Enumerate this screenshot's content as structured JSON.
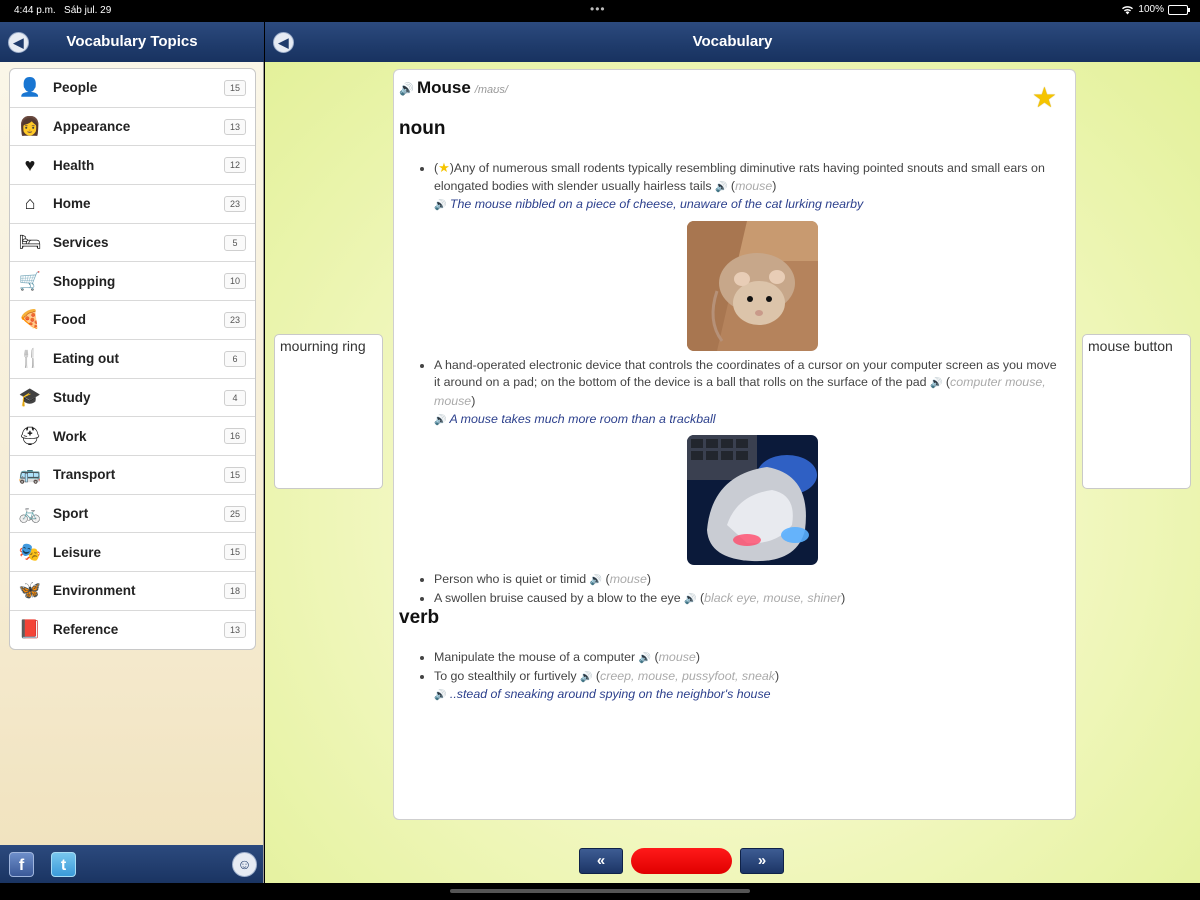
{
  "status": {
    "time": "4:44 p.m.",
    "date": "Sáb jul. 29",
    "battery": "100%",
    "battery_level": 1.0,
    "dots": "•••"
  },
  "sidebar": {
    "title": "Vocabulary Topics",
    "back_icon": "back-arrow-icon",
    "topics": [
      {
        "label": "People",
        "count": "15",
        "icon": "👤"
      },
      {
        "label": "Appearance",
        "count": "13",
        "icon": "👩"
      },
      {
        "label": "Health",
        "count": "12",
        "icon": "♥"
      },
      {
        "label": "Home",
        "count": "23",
        "icon": "⌂"
      },
      {
        "label": "Services",
        "count": "5",
        "icon": "🛏"
      },
      {
        "label": "Shopping",
        "count": "10",
        "icon": "🛒"
      },
      {
        "label": "Food",
        "count": "23",
        "icon": "🍕"
      },
      {
        "label": "Eating out",
        "count": "6",
        "icon": "🍴"
      },
      {
        "label": "Study",
        "count": "4",
        "icon": "🎓"
      },
      {
        "label": "Work",
        "count": "16",
        "icon": "⛑"
      },
      {
        "label": "Transport",
        "count": "15",
        "icon": "🚌"
      },
      {
        "label": "Sport",
        "count": "25",
        "icon": "🚲"
      },
      {
        "label": "Leisure",
        "count": "15",
        "icon": "🎭"
      },
      {
        "label": "Environment",
        "count": "18",
        "icon": "🦋"
      },
      {
        "label": "Reference",
        "count": "13",
        "icon": "📕"
      }
    ],
    "social": {
      "facebook": "f",
      "twitter": "t",
      "accessibility": "☺"
    }
  },
  "main": {
    "title": "Vocabulary",
    "prev_word": "mourning ring",
    "next_word": "mouse button",
    "entry": {
      "word": "Mouse",
      "pronunciation": "/maʊs/",
      "noun_label": "noun",
      "verb_label": "verb",
      "noun_senses": [
        {
          "definition": ")Any of numerous small rodents typically resembling diminutive rats having pointed snouts and small ears on elongated bodies with slender usually hairless tails",
          "synonyms": "mouse",
          "example": "The mouse nibbled on a piece of cheese, unaware of the cat lurking nearby"
        },
        {
          "definition": "A hand-operated electronic device that controls the coordinates of a cursor on your computer screen as you move it around on a pad; on the bottom of the device is a ball that rolls on the surface of the pad",
          "synonyms": "computer mouse, mouse",
          "example": "A mouse takes much more room than a trackball"
        },
        {
          "definition": "Person who is quiet or timid",
          "synonyms": "mouse"
        },
        {
          "definition": "A swollen bruise caused by a blow to the eye",
          "synonyms": "black eye, mouse, shiner"
        }
      ],
      "verb_senses": [
        {
          "definition": "Manipulate the mouse of a computer",
          "synonyms": "mouse"
        },
        {
          "definition": "To go stealthily or furtively",
          "synonyms": "creep, mouse, pussyfoot, sneak",
          "example": "..stead of sneaking around spying on the neighbor's house"
        }
      ]
    },
    "pager": {
      "prev": "«",
      "next": "»"
    }
  }
}
